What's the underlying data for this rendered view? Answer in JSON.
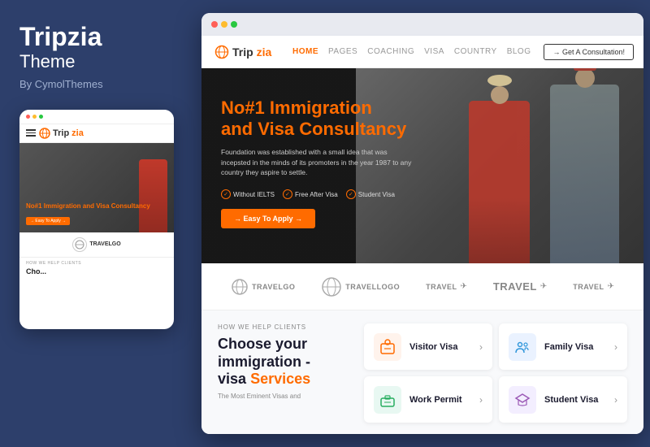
{
  "brand": {
    "name": "Tripzia",
    "subtitle": "Theme",
    "by": "By CymolThemes"
  },
  "desktop": {
    "nav": {
      "logo": "Tripzia",
      "logo_trip": "Trip",
      "logo_zia": "zia",
      "items": [
        {
          "label": "HOME",
          "active": true
        },
        {
          "label": "PAGES",
          "active": false
        },
        {
          "label": "COACHING",
          "active": false
        },
        {
          "label": "VISA",
          "active": false
        },
        {
          "label": "COUNTRY",
          "active": false
        },
        {
          "label": "BLOG",
          "active": false
        }
      ],
      "cta": "→  Get A Consultation!"
    },
    "hero": {
      "title_line1": "No#1 Immigration",
      "title_line2": "and Visa Consultancy",
      "description": "Foundation was established with a small idea that was incepsted in the minds of its promoters in the year 1987 to any country they aspire to settle.",
      "badges": [
        "Without IELTS",
        "Free After Visa",
        "Student Visa"
      ],
      "cta_btn": "→ Easy To Apply →"
    },
    "partners": [
      {
        "name": "TRAVELGO",
        "type": "circle"
      },
      {
        "name": "Travellogo",
        "type": "circle"
      },
      {
        "name": "travel",
        "type": "text-plane"
      },
      {
        "name": "Travel",
        "type": "text-plane"
      },
      {
        "name": "travel",
        "type": "text-plane"
      }
    ],
    "section": {
      "how_label": "HOW WE HELP CLIENTS",
      "title_line1": "Choose your",
      "title_line2": "immigration -",
      "title_line3": "visa",
      "title_services": "Services",
      "description": "The Most Eminent Visas and"
    },
    "visa_cards": [
      {
        "title": "Visitor Visa",
        "icon": "visitor",
        "color": "orange"
      },
      {
        "title": "Family Visa",
        "icon": "family",
        "color": "blue"
      },
      {
        "title": "Work Permit",
        "icon": "work",
        "color": "green"
      },
      {
        "title": "Student Visa",
        "icon": "student",
        "color": "purple"
      }
    ]
  },
  "mobile": {
    "nav": {
      "logo": "Tripzia"
    },
    "hero": {
      "title": "No#1 Immigration and Visa Consultancy",
      "btn": "→ Easy To Apply →"
    },
    "partner": "TRAVELGO",
    "section_label": "HOW WE HELP CLIENTS",
    "section_title": "Cho..."
  },
  "dots": {
    "red": "#ff5f57",
    "yellow": "#febc2e",
    "green": "#28c840"
  }
}
